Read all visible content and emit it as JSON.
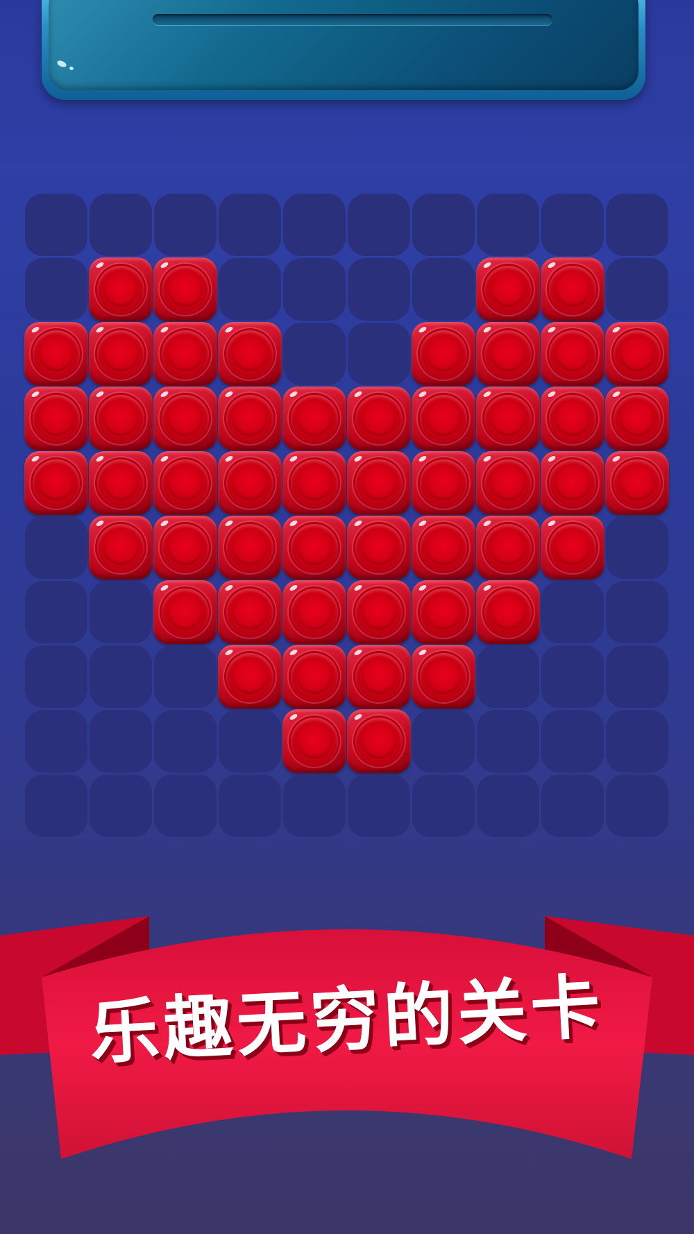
{
  "top_panel": {
    "primary_color": "#2b8fc4",
    "dark_color": "#0a3f64"
  },
  "board": {
    "rows": 10,
    "cols": 10,
    "block_color": "#c4081d",
    "empty_cell_color": "#2a307c",
    "filled": [
      [
        0,
        0,
        0,
        0,
        0,
        0,
        0,
        0,
        0,
        0
      ],
      [
        0,
        1,
        1,
        0,
        0,
        0,
        0,
        1,
        1,
        0
      ],
      [
        1,
        1,
        1,
        1,
        0,
        0,
        1,
        1,
        1,
        1
      ],
      [
        1,
        1,
        1,
        1,
        1,
        1,
        1,
        1,
        1,
        1
      ],
      [
        1,
        1,
        1,
        1,
        1,
        1,
        1,
        1,
        1,
        1
      ],
      [
        0,
        1,
        1,
        1,
        1,
        1,
        1,
        1,
        1,
        0
      ],
      [
        0,
        0,
        1,
        1,
        1,
        1,
        1,
        1,
        0,
        0
      ],
      [
        0,
        0,
        0,
        1,
        1,
        1,
        1,
        0,
        0,
        0
      ],
      [
        0,
        0,
        0,
        0,
        1,
        1,
        0,
        0,
        0,
        0
      ],
      [
        0,
        0,
        0,
        0,
        0,
        0,
        0,
        0,
        0,
        0
      ]
    ]
  },
  "banner": {
    "text": "乐趣无穷的关卡",
    "ribbon_color": "#e8173f",
    "fold_color": "#a8001f"
  }
}
